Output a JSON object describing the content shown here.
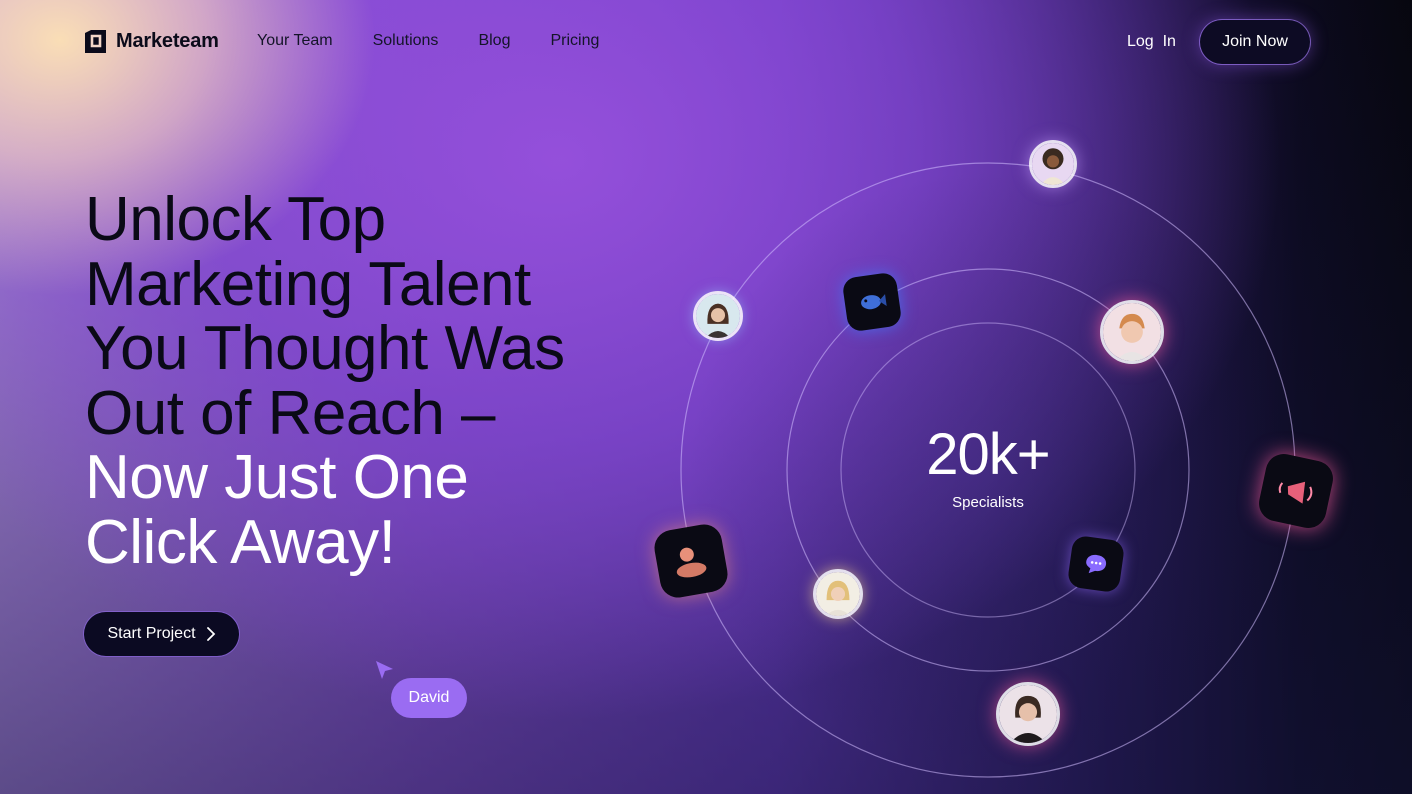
{
  "brand": {
    "name": "Marketeam"
  },
  "nav": {
    "links": [
      "Your Team",
      "Solutions",
      "Blog",
      "Pricing"
    ],
    "login": "Log  In",
    "join": "Join Now"
  },
  "hero": {
    "headline_dark": [
      "Unlock Top",
      "Marketing Talent",
      "You Thought Was",
      "Out of Reach –"
    ],
    "headline_light": [
      "Now Just One",
      "Click Away!"
    ],
    "cta": "Start Project",
    "cursor_name": "David"
  },
  "stats": {
    "value": "20k+",
    "label": "Specialists"
  },
  "colors": {
    "accent": "#9a6cf2",
    "dark_button": "#0d0b24",
    "pink_glow": "#ff5fa0",
    "blue_glow": "#3f7cff"
  },
  "icons": [
    "logo-icon",
    "chevron-right-icon",
    "cursor-arrow-icon",
    "fish-app-icon",
    "people-app-icon",
    "chat-app-icon",
    "megaphone-app-icon"
  ]
}
